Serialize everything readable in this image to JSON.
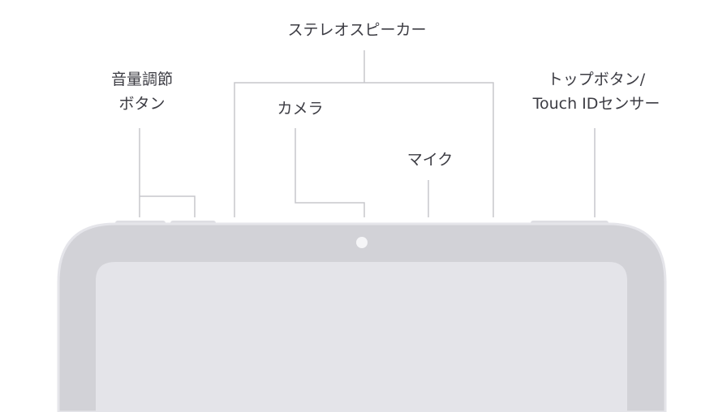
{
  "labels": {
    "stereo_speaker": "ステレオスピーカー",
    "volume_buttons": [
      "音量調節",
      "ボタン"
    ],
    "camera": "カメラ",
    "microphone": "マイク",
    "top_button": [
      "トップボタン/",
      "Touch IDセンサー"
    ]
  },
  "colors": {
    "text": "#3c3c43",
    "leader_line": "#c7c7cc",
    "device_frame": "#d2d2d7",
    "device_outline": "#e5e5ea",
    "screen": "#e4e4e9",
    "side_button": "#dedee3",
    "camera_dot": "#f5f5f7"
  }
}
